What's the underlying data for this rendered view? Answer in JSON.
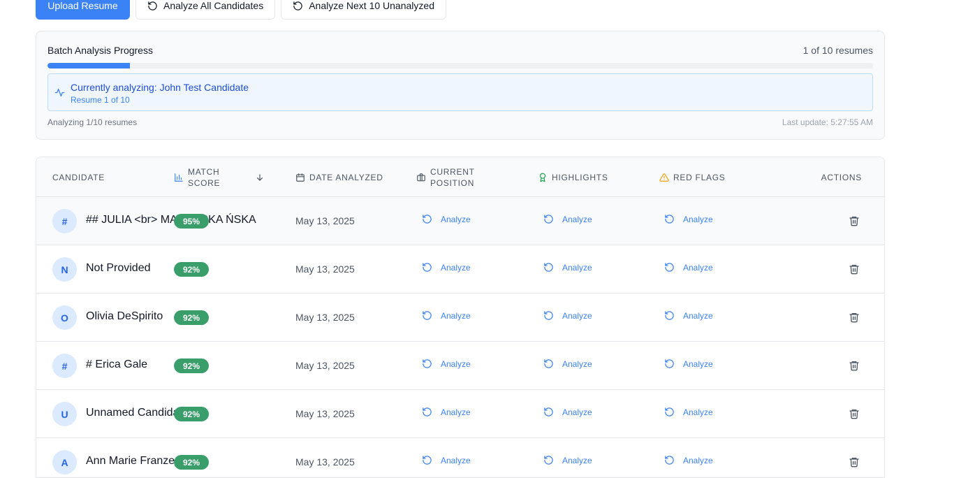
{
  "toolbar": {
    "upload_label": "Upload Resume",
    "analyze_all_label": "Analyze All Candidates",
    "analyze_next_label": "Analyze Next 10 Unanalyzed"
  },
  "batch": {
    "title": "Batch Analysis Progress",
    "count_text": "1 of 10 resumes",
    "progress_fraction": 0.1,
    "current_label": "Currently analyzing: John Test Candidate",
    "current_sub": "Resume 1 of 10",
    "footer_left": "Analyzing 1/10 resumes",
    "footer_right": "Last update: 5:27:55 AM"
  },
  "table": {
    "headers": {
      "candidate": "CANDIDATE",
      "match_score": "MATCH SCORE",
      "date_analyzed": "DATE ANALYZED",
      "current_position": "CURRENT POSITION",
      "highlights": "HIGHLIGHTS",
      "red_flags": "RED FLAGS",
      "actions": "ACTIONS"
    },
    "analyze_label": "Analyze",
    "rows": [
      {
        "initial": "#",
        "name": "## JULIA <br> MAJEWSKA ŃSKA",
        "score": "95%",
        "date": "May 13, 2025"
      },
      {
        "initial": "N",
        "name": "Not Provided",
        "score": "92%",
        "date": "May 13, 2025"
      },
      {
        "initial": "O",
        "name": "Olivia DeSpirito",
        "score": "92%",
        "date": "May 13, 2025"
      },
      {
        "initial": "#",
        "name": "# Erica Gale",
        "score": "92%",
        "date": "May 13, 2025"
      },
      {
        "initial": "U",
        "name": "Unnamed Candidate",
        "score": "92%",
        "date": "May 13, 2025"
      },
      {
        "initial": "A",
        "name": "Ann Marie Franzen",
        "score": "92%",
        "date": "May 13, 2025"
      }
    ]
  },
  "colors": {
    "accent": "#3b82f6",
    "score_badge": "#3a9e6b",
    "highlight_icon": "#16a34a",
    "red_flag_icon": "#f59e0b"
  }
}
